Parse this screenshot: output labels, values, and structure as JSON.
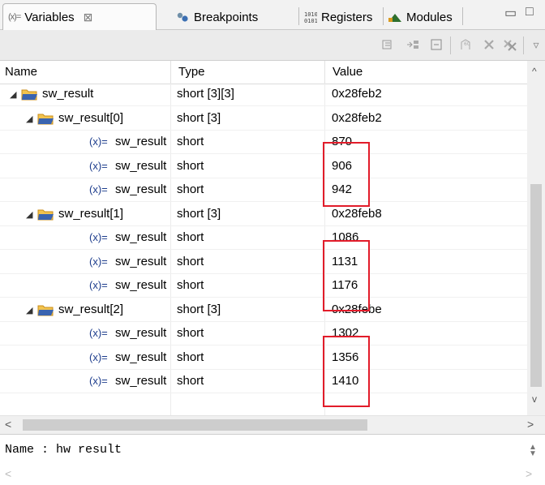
{
  "tabs": [
    {
      "icon": "(x)=",
      "label": "Variables",
      "close": "⊠"
    },
    {
      "icon": "breakpoints-icon",
      "label": "Breakpoints"
    },
    {
      "icon": "registers-icon",
      "label": "Registers"
    },
    {
      "icon": "modules-icon",
      "label": "Modules"
    }
  ],
  "columns": {
    "name": "Name",
    "type": "Type",
    "value": "Value"
  },
  "rows": [
    {
      "level": 0,
      "kind": "array",
      "name": "sw_result",
      "type": "short [3][3]",
      "value": "0x28feb2"
    },
    {
      "level": 1,
      "kind": "array",
      "name": "sw_result[0]",
      "type": "short [3]",
      "value": "0x28feb2"
    },
    {
      "level": 2,
      "kind": "var",
      "name": "sw_result",
      "type": "short",
      "value": "870"
    },
    {
      "level": 2,
      "kind": "var",
      "name": "sw_result",
      "type": "short",
      "value": "906"
    },
    {
      "level": 2,
      "kind": "var",
      "name": "sw_result",
      "type": "short",
      "value": "942"
    },
    {
      "level": 1,
      "kind": "array",
      "name": "sw_result[1]",
      "type": "short [3]",
      "value": "0x28feb8"
    },
    {
      "level": 2,
      "kind": "var",
      "name": "sw_result",
      "type": "short",
      "value": "1086"
    },
    {
      "level": 2,
      "kind": "var",
      "name": "sw_result",
      "type": "short",
      "value": "1131"
    },
    {
      "level": 2,
      "kind": "var",
      "name": "sw_result",
      "type": "short",
      "value": "1176"
    },
    {
      "level": 1,
      "kind": "array",
      "name": "sw_result[2]",
      "type": "short [3]",
      "value": "0x28febe"
    },
    {
      "level": 2,
      "kind": "var",
      "name": "sw_result",
      "type": "short",
      "value": "1302"
    },
    {
      "level": 2,
      "kind": "var",
      "name": "sw_result",
      "type": "short",
      "value": "1356"
    },
    {
      "level": 2,
      "kind": "var",
      "name": "sw_result",
      "type": "short",
      "value": "1410"
    }
  ],
  "var_icon_text": "(x)=",
  "details": {
    "text": "Name : hw result"
  },
  "colors": {
    "highlight": "#e21c2a",
    "accent": "#1c3c8c"
  }
}
